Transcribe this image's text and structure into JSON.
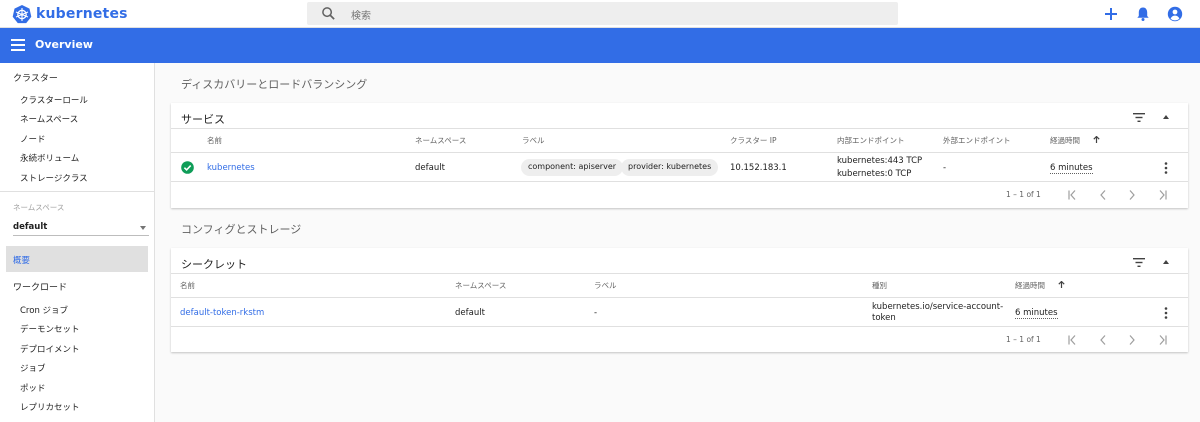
{
  "header": {
    "brand": "kubernetes",
    "search_placeholder": "検索",
    "icons": [
      "kubernetes-logo-icon",
      "search-icon",
      "add-icon",
      "notifications-icon",
      "account-icon"
    ]
  },
  "toolbar": {
    "title": "Overview"
  },
  "sidebar": {
    "cluster_heading": "クラスター",
    "cluster_items": [
      "クラスターロール",
      "ネームスペース",
      "ノード",
      "永続ボリューム",
      "ストレージクラス"
    ],
    "namespace_label": "ネームスペース",
    "namespace_value": "default",
    "active_item": "概要",
    "workload_heading": "ワークロード",
    "workload_items": [
      "Cron ジョブ",
      "デーモンセット",
      "デプロイメント",
      "ジョブ",
      "ポッド",
      "レプリカセット"
    ]
  },
  "discovery": {
    "section_title": "ディスカバリーとロードバランシング",
    "card_title": "サービス",
    "columns": [
      "名前",
      "ネームスペース",
      "ラベル",
      "クラスター IP",
      "内部エンドポイント",
      "外部エンドポイント",
      "経過時間"
    ],
    "rows": [
      {
        "status": "ok",
        "name": "kubernetes",
        "namespace": "default",
        "labels": [
          "component: apiserver",
          "provider: kubernetes"
        ],
        "cluster_ip": "10.152.183.1",
        "internal_endpoints": [
          "kubernetes:443 TCP",
          "kubernetes:0 TCP"
        ],
        "external_endpoints": "-",
        "age": "6 minutes"
      }
    ],
    "pagination": "1 – 1 of 1"
  },
  "config": {
    "section_title": "コンフィグとストレージ",
    "card_title": "シークレット",
    "columns": [
      "名前",
      "ネームスペース",
      "ラベル",
      "種別",
      "経過時間"
    ],
    "rows": [
      {
        "name": "default-token-rkstm",
        "namespace": "default",
        "labels": "-",
        "type_line1": "kubernetes.io/service-account-",
        "type_line2": "token",
        "age": "6 minutes"
      }
    ],
    "pagination": "1 – 1 of 1"
  },
  "colors": {
    "primary": "#326de6",
    "status_ok": "#0f9d58",
    "background": "#fafafa"
  }
}
